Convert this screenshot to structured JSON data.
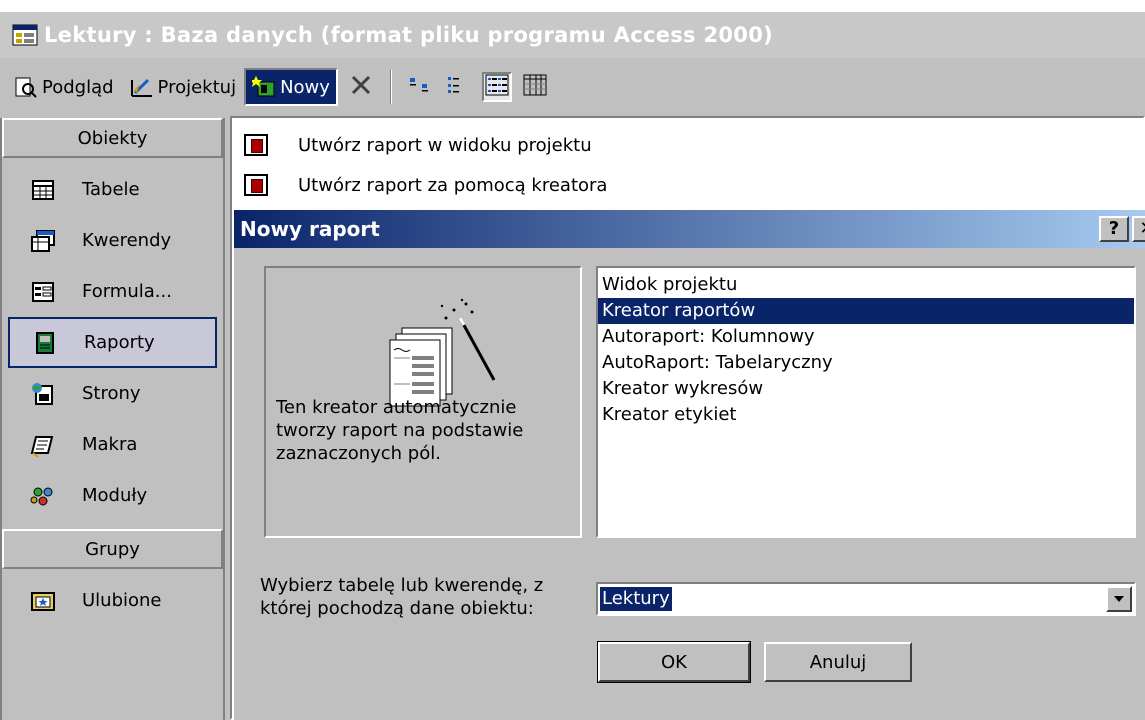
{
  "window": {
    "title": "Lektury : Baza danych (format pliku programu Access 2000)"
  },
  "toolbar": {
    "preview_label": "Podgląd",
    "design_label": "Projektuj",
    "new_label": "Nowy"
  },
  "sidebar": {
    "objects_header": "Obiekty",
    "items": [
      {
        "label": "Tabele",
        "icon": "table-icon"
      },
      {
        "label": "Kwerendy",
        "icon": "query-icon"
      },
      {
        "label": "Formula...",
        "icon": "form-icon"
      },
      {
        "label": "Raporty",
        "icon": "report-icon",
        "selected": true
      },
      {
        "label": "Strony",
        "icon": "page-icon"
      },
      {
        "label": "Makra",
        "icon": "macro-icon"
      },
      {
        "label": "Moduły",
        "icon": "module-icon"
      }
    ],
    "groups_header": "Grupy",
    "groups": [
      {
        "label": "Ulubione",
        "icon": "favorites-icon"
      }
    ]
  },
  "list": {
    "items": [
      "Utwórz raport w widoku projektu",
      "Utwórz raport za pomocą kreatora"
    ]
  },
  "dialog": {
    "title": "Nowy raport",
    "help_label": "?",
    "close_label": "✕",
    "description": "Ten kreator automatycznie tworzy raport na podstawie zaznaczonych pól.",
    "options": [
      "Widok projektu",
      "Kreator raportów",
      "Autoraport:  Kolumnowy",
      "AutoRaport:  Tabelaryczny",
      "Kreator wykresów",
      "Kreator etykiet"
    ],
    "selected_option": "Kreator raportów",
    "source_label": "Wybierz tabelę lub kwerendę, z której pochodzą dane obiektu:",
    "source_value": "Lektury",
    "ok_label": "OK",
    "cancel_label": "Anuluj"
  },
  "colors": {
    "selection": "#0a246a",
    "face": "#c0c0c0"
  }
}
